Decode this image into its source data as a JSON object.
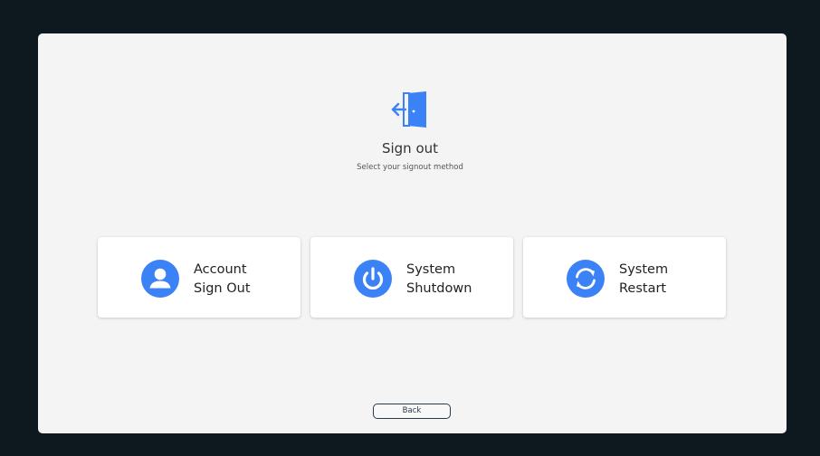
{
  "header": {
    "icon": "door-exit-icon",
    "title": "Sign out",
    "subtitle": "Select your signout method"
  },
  "options": [
    {
      "line1": "Account",
      "line2": "Sign Out",
      "icon": "user-icon"
    },
    {
      "line1": "System",
      "line2": "Shutdown",
      "icon": "power-icon"
    },
    {
      "line1": "System",
      "line2": "Restart",
      "icon": "restart-icon"
    }
  ],
  "footer": {
    "back_label": "Back"
  },
  "colors": {
    "accent": "#3b82f6",
    "background": "#0d181f",
    "panel": "#f4f4f5",
    "card": "#ffffff"
  }
}
